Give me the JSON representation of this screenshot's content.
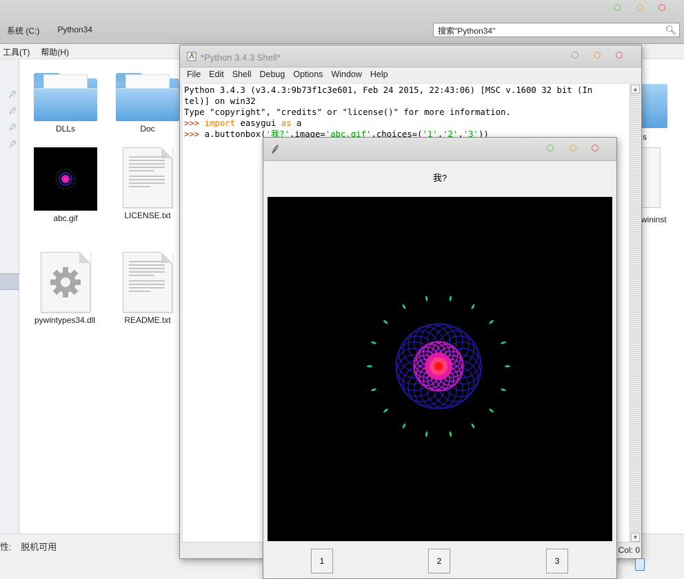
{
  "explorer": {
    "breadcrumb": [
      "系统 (C:)",
      "Python34"
    ],
    "search_value": "搜索\"Python34\"",
    "menu": [
      "工具(T)",
      "帮助(H)"
    ],
    "files": [
      {
        "name": "DLLs",
        "type": "folder"
      },
      {
        "name": "Doc",
        "type": "folder"
      },
      {
        "name": "abc.gif",
        "type": "image"
      },
      {
        "name": "LICENSE.txt",
        "type": "text"
      },
      {
        "name": "pywintypes34.dll",
        "type": "dll"
      },
      {
        "name": "README.txt",
        "type": "text"
      }
    ],
    "partial_right_labels": [
      "s",
      "wininst"
    ],
    "status_label": "性:",
    "status_value": "脱机可用"
  },
  "shell": {
    "title": "*Python 3.4.3 Shell*",
    "menu": [
      "File",
      "Edit",
      "Shell",
      "Debug",
      "Options",
      "Window",
      "Help"
    ],
    "banner_line1": "Python 3.4.3 (v3.4.3:9b73f1c3e601, Feb 24 2015, 22:43:06) [MSC v.1600 32 bit (In",
    "banner_line2": "tel)] on win32",
    "banner_line3": "Type \"copyright\", \"credits\" or \"license()\" for more information.",
    "prompt": ">>> ",
    "cmd1": {
      "kw_import": "import",
      "mod": " easygui ",
      "kw_as": "as",
      "alias": " a"
    },
    "cmd2": {
      "pre": "a.buttonbox(",
      "s1": "'我?'",
      "mid1": ",image=",
      "s2": "'abc.gif'",
      "mid2": ",choices=(",
      "s3": "'1'",
      "c1": ",",
      "s4": "'2'",
      "c2": ",",
      "s5": "'3'",
      "post": "))"
    },
    "status_col": "Col: 0"
  },
  "dialog": {
    "message": "我?",
    "buttons": [
      "1",
      "2",
      "3"
    ]
  },
  "colors": {
    "dot_green": "#6cc46a",
    "dot_orange": "#e9a14f",
    "dot_red": "#e0645a",
    "prompt": "#c12b00",
    "keyword": "#ff7700",
    "string": "#00a000"
  }
}
